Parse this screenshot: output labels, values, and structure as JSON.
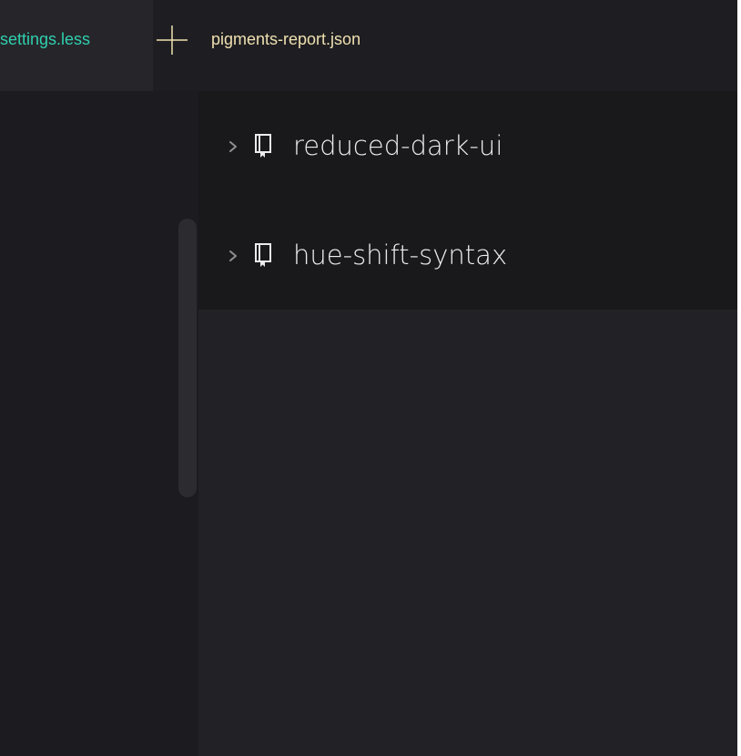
{
  "colors": {
    "active_tab_text": "#2fcfae",
    "inactive_tab_text": "#efe0b0",
    "plus_icon": "#efe0b0",
    "tree_text": "#ececec",
    "chevron": "#8e8e92"
  },
  "tabs": {
    "active": {
      "label": "-settings.less"
    },
    "new_tab": {
      "icon": "plus-icon"
    },
    "inactive": {
      "label": "pigments-report.json"
    }
  },
  "tree": {
    "items": [
      {
        "label": "reduced-dark-ui",
        "icon": "book-icon",
        "expanded": false
      },
      {
        "label": "hue-shift-syntax",
        "icon": "book-icon",
        "expanded": false
      }
    ]
  }
}
